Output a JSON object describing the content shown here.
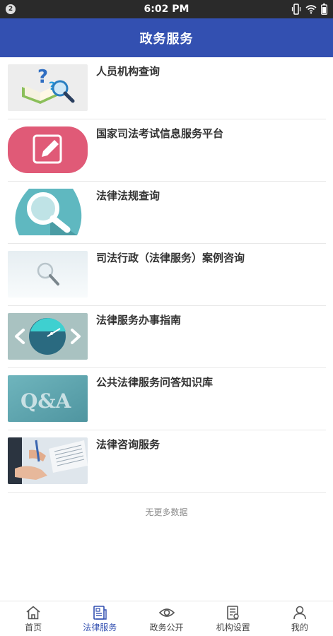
{
  "status_bar": {
    "notification_count": "2",
    "time": "6:02 PM",
    "icons": [
      "vibrate-icon",
      "wifi-icon",
      "battery-icon"
    ]
  },
  "header": {
    "title": "政务服务"
  },
  "colors": {
    "brand": "#3350b1",
    "active_tab": "#3350b1"
  },
  "list": {
    "items": [
      {
        "title": "人员机构查询",
        "thumb": "question-book-magnifier"
      },
      {
        "title": "国家司法考试信息服务平台",
        "thumb": "edit-pencil-pink"
      },
      {
        "title": "法律法规查询",
        "thumb": "magnifier-teal"
      },
      {
        "title": "司法行政（法律服务）案例咨询",
        "thumb": "magnifier-light"
      },
      {
        "title": "法律服务办事指南",
        "thumb": "compass-arrows"
      },
      {
        "title": "公共法律服务问答知识库",
        "thumb": "qa-text"
      },
      {
        "title": "法律咨询服务",
        "thumb": "handshake-paper"
      }
    ],
    "no_more": "无更多数据"
  },
  "tabbar": {
    "tabs": [
      {
        "label": "首页",
        "icon": "home-icon",
        "active": false
      },
      {
        "label": "法律服务",
        "icon": "document-icon",
        "active": true
      },
      {
        "label": "政务公开",
        "icon": "eye-icon",
        "active": false
      },
      {
        "label": "机构设置",
        "icon": "list-settings-icon",
        "active": false
      },
      {
        "label": "我的",
        "icon": "user-icon",
        "active": false
      }
    ]
  }
}
